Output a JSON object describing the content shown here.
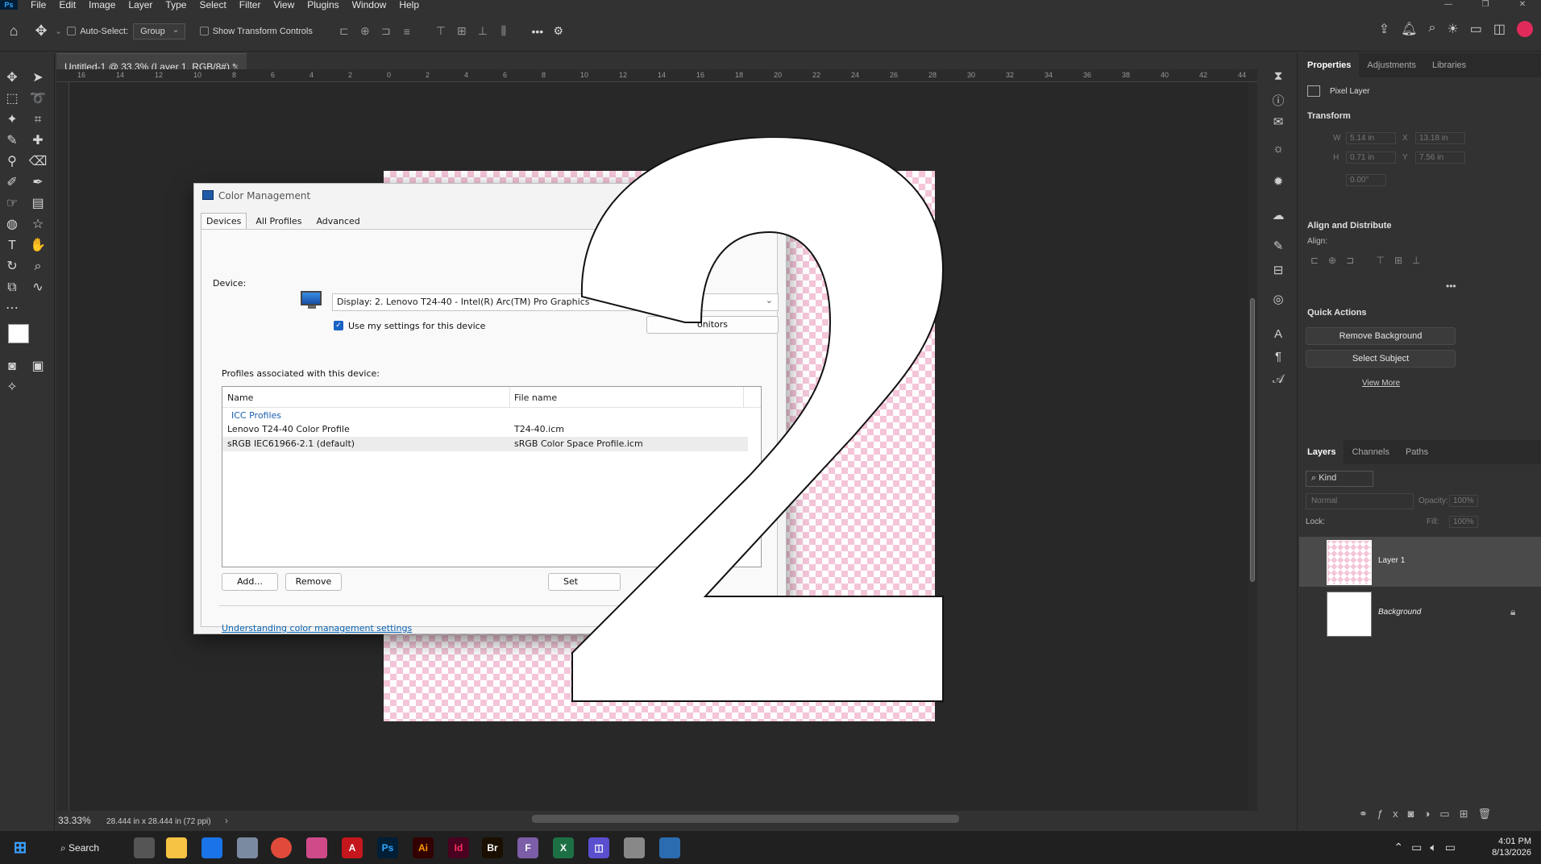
{
  "menubar": {
    "logo": "Ps",
    "items": [
      "File",
      "Edit",
      "Image",
      "Layer",
      "Type",
      "Select",
      "Filter",
      "View",
      "Plugins",
      "Window",
      "Help"
    ]
  },
  "options": {
    "auto_select_label": "Auto-Select:",
    "auto_select_value": "Group",
    "show_transform_label": "Show Transform Controls"
  },
  "document": {
    "tab_title": "Untitled-1 @ 33.3% (Layer 1, RGB/8#) *",
    "zoom": "33.33%",
    "doc_size": "28.444 in x 28.444 in (72 ppi)",
    "ruler_labels": [
      "16",
      "14",
      "12",
      "10",
      "8",
      "6",
      "4",
      "2",
      "0",
      "2",
      "4",
      "6",
      "8",
      "10",
      "12",
      "14",
      "16",
      "18",
      "20",
      "22",
      "24",
      "26",
      "28",
      "30",
      "32",
      "34",
      "36",
      "38",
      "40",
      "42",
      "44"
    ]
  },
  "dialog": {
    "title": "Color Management",
    "tabs": [
      "Devices",
      "All Profiles",
      "Advanced"
    ],
    "device_label": "Device:",
    "device_value": "Display: 2. Lenovo T24-40 - Intel(R) Arc(TM) Pro Graphics",
    "use_settings": "Use my settings for this device",
    "monitors_btn": "onitors",
    "profiles_label": "Profiles associated with this device:",
    "col_name": "Name",
    "col_file": "File name",
    "group": "ICC Profiles",
    "rows": [
      {
        "name": "Lenovo T24-40 Color Profile",
        "file": "T24-40.icm"
      },
      {
        "name": "sRGB IEC61966-2.1 (default)",
        "file": "sRGB Color Space Profile.icm"
      }
    ],
    "add_btn": "Add...",
    "remove_btn": "Remove",
    "set_btn": "Set",
    "link": "Understanding color management settings"
  },
  "properties": {
    "tabs": [
      "Properties",
      "Adjustments",
      "Libraries"
    ],
    "layer_type": "Pixel Layer",
    "transform": "Transform",
    "w_label": "W",
    "w_value": "5.14 in",
    "x_label": "X",
    "x_value": "13.18 in",
    "h_label": "H",
    "h_value": "0.71 in",
    "y_label": "Y",
    "y_value": "7.56 in",
    "angle_value": "0.00°",
    "align_title": "Align and Distribute",
    "align_label": "Align:",
    "quick_title": "Quick Actions",
    "remove_bg": "Remove Background",
    "select_subject": "Select Subject",
    "view_more": "View More"
  },
  "layers": {
    "tabs": [
      "Layers",
      "Channels",
      "Paths"
    ],
    "kind": "Kind",
    "blend": "Normal",
    "opacity_label": "Opacity:",
    "opacity_value": "100%",
    "lock_label": "Lock:",
    "fill_label": "Fill:",
    "fill_value": "100%",
    "items": [
      {
        "name": "Layer 1"
      },
      {
        "name": "Background"
      }
    ]
  },
  "taskbar": {
    "search": "Search",
    "time": "4:01 PM",
    "date": "8/13/2026"
  }
}
